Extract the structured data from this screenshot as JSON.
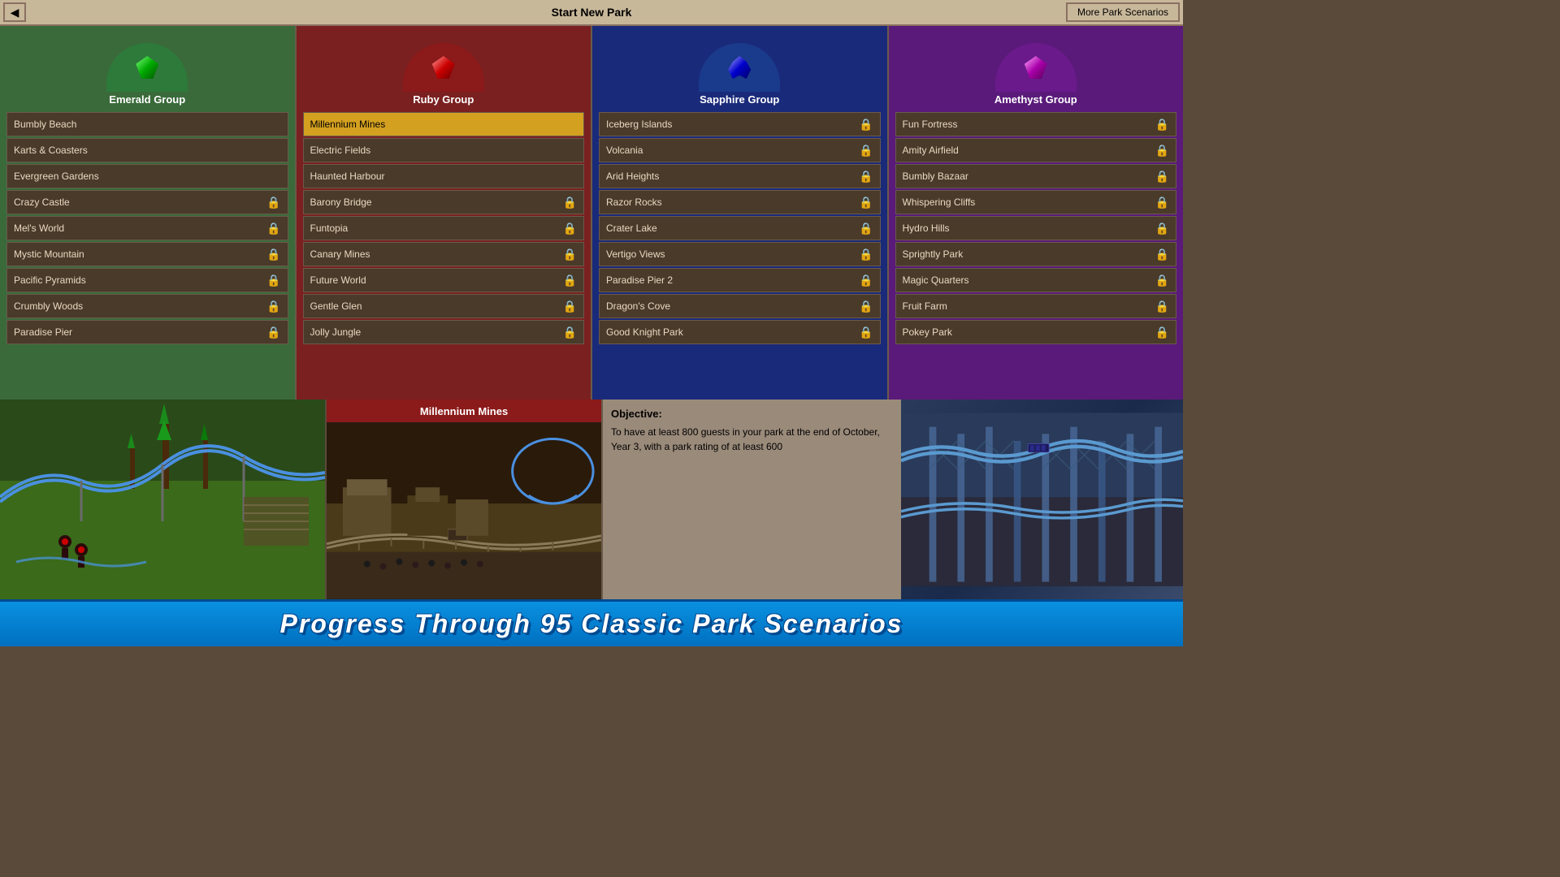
{
  "titleBar": {
    "title": "Start New Park",
    "backLabel": "◀",
    "moreScenariosLabel": "More Park Scenarios"
  },
  "groups": [
    {
      "id": "emerald",
      "name": "Emerald Group",
      "gemType": "emerald",
      "scenarios": [
        {
          "name": "Bumbly Beach",
          "locked": false
        },
        {
          "name": "Karts & Coasters",
          "locked": false
        },
        {
          "name": "Evergreen Gardens",
          "locked": false
        },
        {
          "name": "Crazy Castle",
          "locked": true
        },
        {
          "name": "Mel's World",
          "locked": true
        },
        {
          "name": "Mystic Mountain",
          "locked": true
        },
        {
          "name": "Pacific Pyramids",
          "locked": true
        },
        {
          "name": "Crumbly Woods",
          "locked": true
        },
        {
          "name": "Paradise Pier",
          "locked": true
        }
      ]
    },
    {
      "id": "ruby",
      "name": "Ruby Group",
      "gemType": "ruby",
      "scenarios": [
        {
          "name": "Millennium Mines",
          "locked": false,
          "selected": true
        },
        {
          "name": "Electric Fields",
          "locked": false
        },
        {
          "name": "Haunted Harbour",
          "locked": false
        },
        {
          "name": "Barony Bridge",
          "locked": true
        },
        {
          "name": "Funtopia",
          "locked": true
        },
        {
          "name": "Canary Mines",
          "locked": true
        },
        {
          "name": "Future World",
          "locked": true
        },
        {
          "name": "Gentle Glen",
          "locked": true
        },
        {
          "name": "Jolly Jungle",
          "locked": true
        }
      ]
    },
    {
      "id": "sapphire",
      "name": "Sapphire Group",
      "gemType": "sapphire",
      "scenarios": [
        {
          "name": "Iceberg Islands",
          "locked": true
        },
        {
          "name": "Volcania",
          "locked": true
        },
        {
          "name": "Arid Heights",
          "locked": true
        },
        {
          "name": "Razor Rocks",
          "locked": true
        },
        {
          "name": "Crater Lake",
          "locked": true
        },
        {
          "name": "Vertigo Views",
          "locked": true
        },
        {
          "name": "Paradise Pier 2",
          "locked": true
        },
        {
          "name": "Dragon's Cove",
          "locked": true
        },
        {
          "name": "Good Knight Park",
          "locked": true
        }
      ]
    },
    {
      "id": "amethyst",
      "name": "Amethyst Group",
      "gemType": "amethyst",
      "scenarios": [
        {
          "name": "Fun Fortress",
          "locked": true
        },
        {
          "name": "Amity Airfield",
          "locked": true
        },
        {
          "name": "Bumbly Bazaar",
          "locked": true
        },
        {
          "name": "Whispering Cliffs",
          "locked": true
        },
        {
          "name": "Hydro Hills",
          "locked": true
        },
        {
          "name": "Sprightly Park",
          "locked": true
        },
        {
          "name": "Magic Quarters",
          "locked": true
        },
        {
          "name": "Fruit Farm",
          "locked": true
        },
        {
          "name": "Pokey Park",
          "locked": true
        }
      ]
    }
  ],
  "bottomPanel": {
    "previewTitle": "Millennium Mines",
    "objective": {
      "title": "Objective:",
      "text": "To have at least 800 guests in your park at the end of October, Year 3, with a park rating of at least 600"
    }
  },
  "banner": {
    "text": "Progress Through 95 Classic Park Scenarios"
  }
}
